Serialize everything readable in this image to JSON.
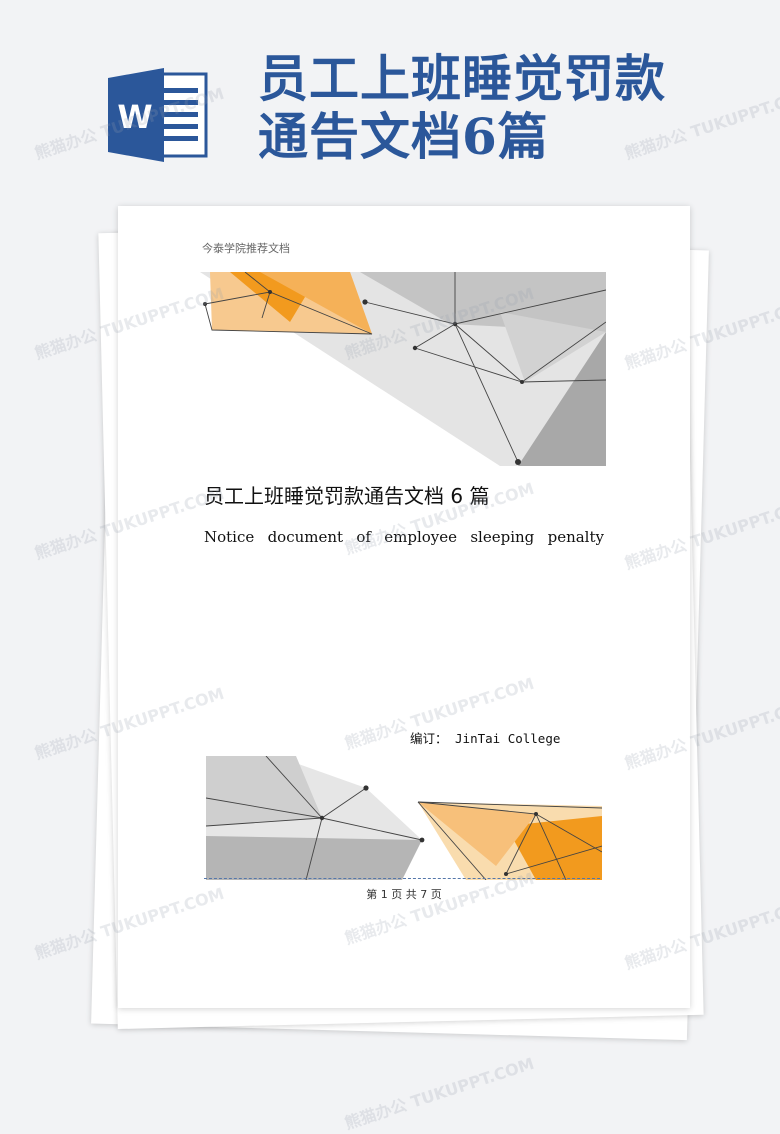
{
  "banner": {
    "title_line1": "员工上班睡觉罚款",
    "title_line2": "通告文档6篇",
    "icon_letter": "W"
  },
  "document": {
    "school_header": "今泰学院推荐文档",
    "title": "员工上班睡觉罚款通告文档 6 篇",
    "subtitle_words": [
      "Notice",
      "document",
      "of",
      "employee",
      "sleeping",
      "penalty"
    ],
    "editor": "编订： JinTai  College",
    "page_number": "第 1 页 共 7 页"
  },
  "watermark": {
    "text": "熊猫办公 TUKUPPT.COM"
  },
  "colors": {
    "brand_blue": "#2b579a",
    "accent_orange": "#f29a1e",
    "art_gray": "#b9b9b9"
  }
}
